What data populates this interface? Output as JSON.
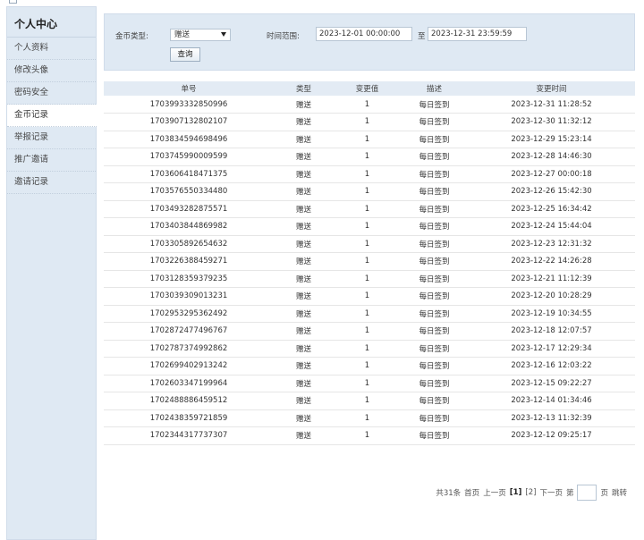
{
  "sidebar": {
    "title": "个人中心",
    "items": [
      {
        "label": "个人资料"
      },
      {
        "label": "修改头像"
      },
      {
        "label": "密码安全"
      },
      {
        "label": "金币记录"
      },
      {
        "label": "举报记录"
      },
      {
        "label": "推广邀请"
      },
      {
        "label": "邀请记录"
      }
    ]
  },
  "filter": {
    "type_label": "金币类型:",
    "type_value": "赠送",
    "time_label": "时间范围:",
    "start": "2023-12-01 00:00:00",
    "to_label": "至",
    "end": "2023-12-31 23:59:59",
    "query_button": "查询"
  },
  "table": {
    "headers": [
      "单号",
      "类型",
      "变更值",
      "描述",
      "变更时间"
    ],
    "rows": [
      [
        "1703993332850996",
        "赠送",
        "1",
        "每日签到",
        "2023-12-31 11:28:52"
      ],
      [
        "1703907132802107",
        "赠送",
        "1",
        "每日签到",
        "2023-12-30 11:32:12"
      ],
      [
        "1703834594698496",
        "赠送",
        "1",
        "每日签到",
        "2023-12-29 15:23:14"
      ],
      [
        "1703745990009599",
        "赠送",
        "1",
        "每日签到",
        "2023-12-28 14:46:30"
      ],
      [
        "1703606418471375",
        "赠送",
        "1",
        "每日签到",
        "2023-12-27 00:00:18"
      ],
      [
        "1703576550334480",
        "赠送",
        "1",
        "每日签到",
        "2023-12-26 15:42:30"
      ],
      [
        "1703493282875571",
        "赠送",
        "1",
        "每日签到",
        "2023-12-25 16:34:42"
      ],
      [
        "1703403844869982",
        "赠送",
        "1",
        "每日签到",
        "2023-12-24 15:44:04"
      ],
      [
        "1703305892654632",
        "赠送",
        "1",
        "每日签到",
        "2023-12-23 12:31:32"
      ],
      [
        "1703226388459271",
        "赠送",
        "1",
        "每日签到",
        "2023-12-22 14:26:28"
      ],
      [
        "1703128359379235",
        "赠送",
        "1",
        "每日签到",
        "2023-12-21 11:12:39"
      ],
      [
        "1703039309013231",
        "赠送",
        "1",
        "每日签到",
        "2023-12-20 10:28:29"
      ],
      [
        "1702953295362492",
        "赠送",
        "1",
        "每日签到",
        "2023-12-19 10:34:55"
      ],
      [
        "1702872477496767",
        "赠送",
        "1",
        "每日签到",
        "2023-12-18 12:07:57"
      ],
      [
        "1702787374992862",
        "赠送",
        "1",
        "每日签到",
        "2023-12-17 12:29:34"
      ],
      [
        "1702699402913242",
        "赠送",
        "1",
        "每日签到",
        "2023-12-16 12:03:22"
      ],
      [
        "1702603347199964",
        "赠送",
        "1",
        "每日签到",
        "2023-12-15 09:22:27"
      ],
      [
        "1702488886459512",
        "赠送",
        "1",
        "每日签到",
        "2023-12-14 01:34:46"
      ],
      [
        "1702438359721859",
        "赠送",
        "1",
        "每日签到",
        "2023-12-13 11:32:39"
      ],
      [
        "1702344317737307",
        "赠送",
        "1",
        "每日签到",
        "2023-12-12 09:25:17"
      ]
    ]
  },
  "pager": {
    "total": "共31条",
    "first": "首页",
    "prev": "上一页",
    "page1": "[1]",
    "page2": "[2]",
    "next": "下一页",
    "goto_prefix": "第",
    "goto_suffix": "页",
    "jump": "跳转"
  }
}
